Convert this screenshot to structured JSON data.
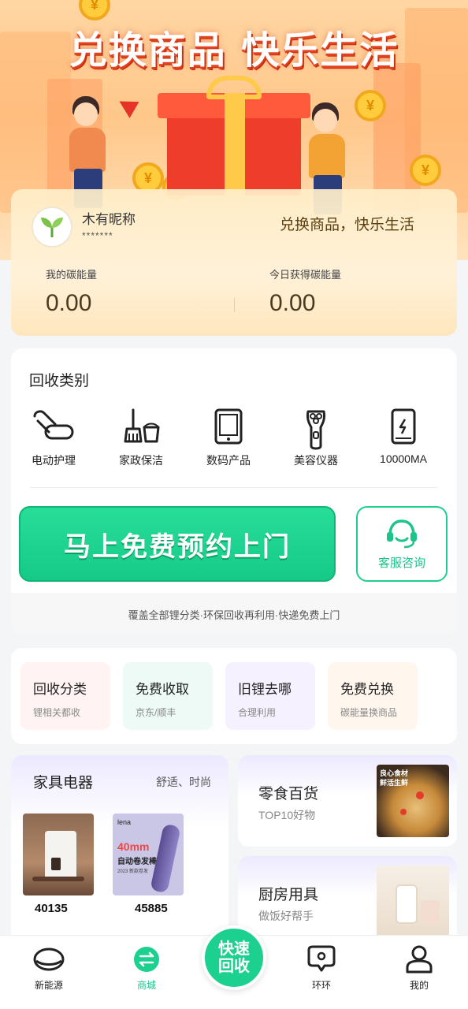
{
  "banner": {
    "title": "兑换商品 快乐生活"
  },
  "profile": {
    "nickname": "木有昵称",
    "masked_id": "*******",
    "slogan": "兑换商品，快乐生活",
    "stats": [
      {
        "label": "我的碳能量",
        "value": "0.00"
      },
      {
        "label": "今日获得碳能量",
        "value": "0.00"
      }
    ]
  },
  "recycle": {
    "title": "回收类别",
    "categories": [
      {
        "label": "电动护理",
        "icon": "hair-dryer-icon"
      },
      {
        "label": "家政保洁",
        "icon": "broom-bucket-icon"
      },
      {
        "label": "数码产品",
        "icon": "tablet-icon"
      },
      {
        "label": "美容仪器",
        "icon": "shaver-icon"
      },
      {
        "label": "10000MA",
        "icon": "power-bank-icon"
      }
    ],
    "book_button": "马上免费预约上门",
    "service_button": "客服咨询",
    "coverage": "覆盖全部锂分类·环保回收再利用·快递免费上门"
  },
  "quick_links": [
    {
      "title": "回收分类",
      "sub": "锂相关都收",
      "bg": "#fff3f3"
    },
    {
      "title": "免费收取",
      "sub": "京东/顺丰",
      "bg": "#eefaf6"
    },
    {
      "title": "旧锂去哪",
      "sub": "合理利用",
      "bg": "#f5f1ff"
    },
    {
      "title": "免费兑换",
      "sub": "碳能量换商品",
      "bg": "#fff6ee"
    }
  ],
  "products": {
    "appliance": {
      "title": "家具电器",
      "subtitle": "舒适、时尚",
      "items": [
        {
          "number": "40135"
        },
        {
          "number": "45885",
          "img_brand": "lena",
          "img_headline": "40mm",
          "img_caption": "自动卷发棒",
          "img_year": "2023 新款卷发"
        }
      ]
    },
    "snacks": {
      "title": "零食百货",
      "subtitle": "TOP10好物",
      "img_caption_1": "良心食材",
      "img_caption_2": "鲜活生鲜"
    },
    "kitchen": {
      "title": "厨房用具",
      "subtitle": "做饭好帮手"
    }
  },
  "nav": {
    "items": [
      {
        "label": "新能源"
      },
      {
        "label": "商城"
      },
      {
        "label": "环环"
      },
      {
        "label": "我的"
      }
    ],
    "center_line1": "快速",
    "center_line2": "回收"
  },
  "colors": {
    "accent": "#1cd08f",
    "banner_title_shadow": "#e2421f",
    "profile_bg": "#fff1d8"
  }
}
